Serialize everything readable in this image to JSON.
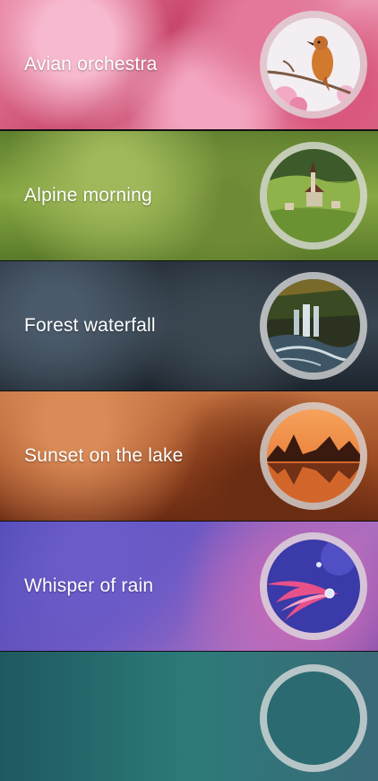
{
  "sounds": [
    {
      "label": "Avian orchestra",
      "thumbnail": "bird-on-blossom-branch-icon"
    },
    {
      "label": "Alpine morning",
      "thumbnail": "alpine-village-icon"
    },
    {
      "label": "Forest waterfall",
      "thumbnail": "waterfall-icon"
    },
    {
      "label": "Sunset on the lake",
      "thumbnail": "lake-sunset-icon"
    },
    {
      "label": "Whisper of rain",
      "thumbnail": "raindrop-flower-icon"
    }
  ]
}
